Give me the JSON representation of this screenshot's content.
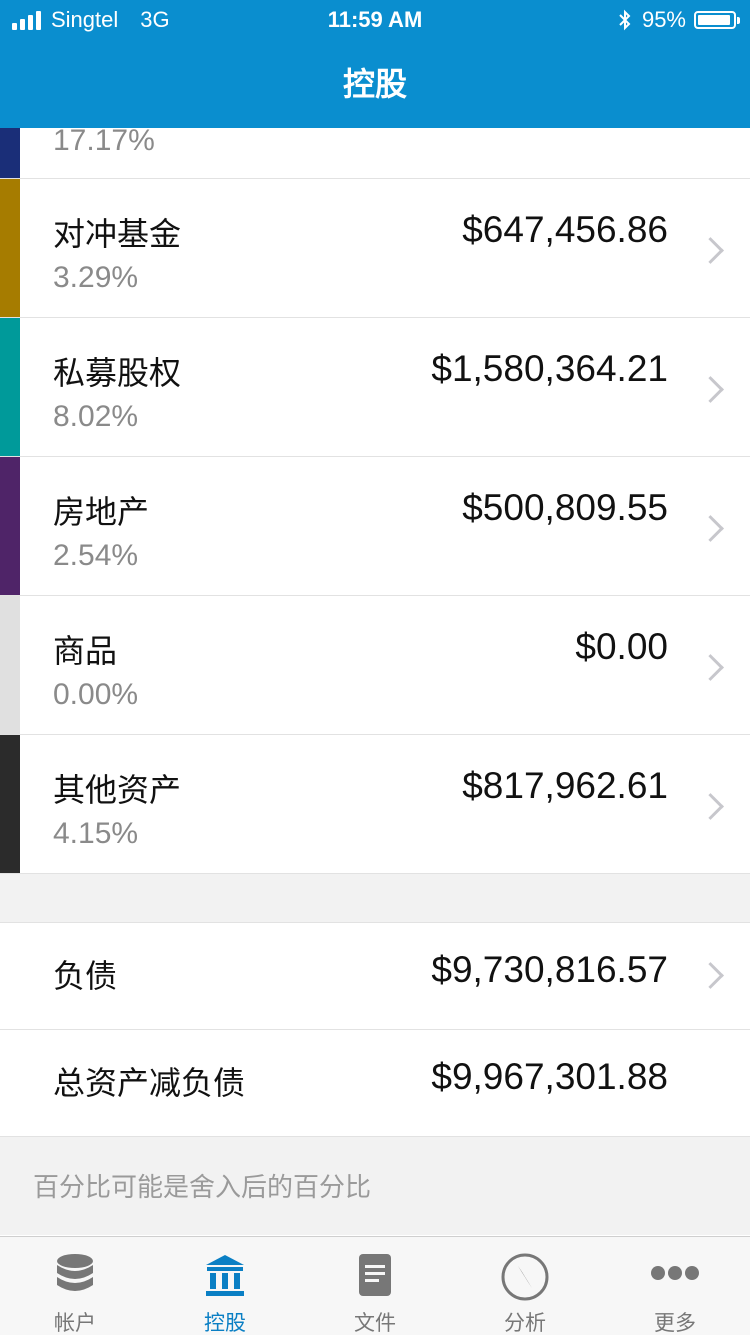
{
  "status": {
    "carrier": "Singtel",
    "network": "3G",
    "time": "11:59 AM",
    "battery": "95%",
    "battery_level": 0.95
  },
  "nav": {
    "title": "控股"
  },
  "top_partial": {
    "pct": "17.17%",
    "color": "#1a2e78"
  },
  "rows": [
    {
      "name": "对冲基金",
      "amount": "$647,456.86",
      "pct": "3.29%",
      "color": "#a67c00"
    },
    {
      "name": "私募股权",
      "amount": "$1,580,364.21",
      "pct": "8.02%",
      "color": "#009a9a"
    },
    {
      "name": "房地产",
      "amount": "$500,809.55",
      "pct": "2.54%",
      "color": "#4f2468"
    },
    {
      "name": "商品",
      "amount": "$0.00",
      "pct": "0.00%",
      "color": "#e0e0e0"
    },
    {
      "name": "其他资产",
      "amount": "$817,962.61",
      "pct": "4.15%",
      "color": "#2b2b2b"
    }
  ],
  "summary": {
    "liabilities_label": "负债",
    "liabilities_amount": "$9,730,816.57",
    "net_label": "总资产减负债",
    "net_amount": "$9,967,301.88"
  },
  "footnote": "百分比可能是舍入后的百分比",
  "tabs": [
    {
      "label": "帐户",
      "icon": "database-icon"
    },
    {
      "label": "控股",
      "icon": "bank-icon"
    },
    {
      "label": "文件",
      "icon": "document-icon"
    },
    {
      "label": "分析",
      "icon": "compass-icon"
    },
    {
      "label": "更多",
      "icon": "more-icon"
    }
  ],
  "colors": {
    "brand": "#0a8ecf",
    "active_tab": "#0a7fc4"
  }
}
